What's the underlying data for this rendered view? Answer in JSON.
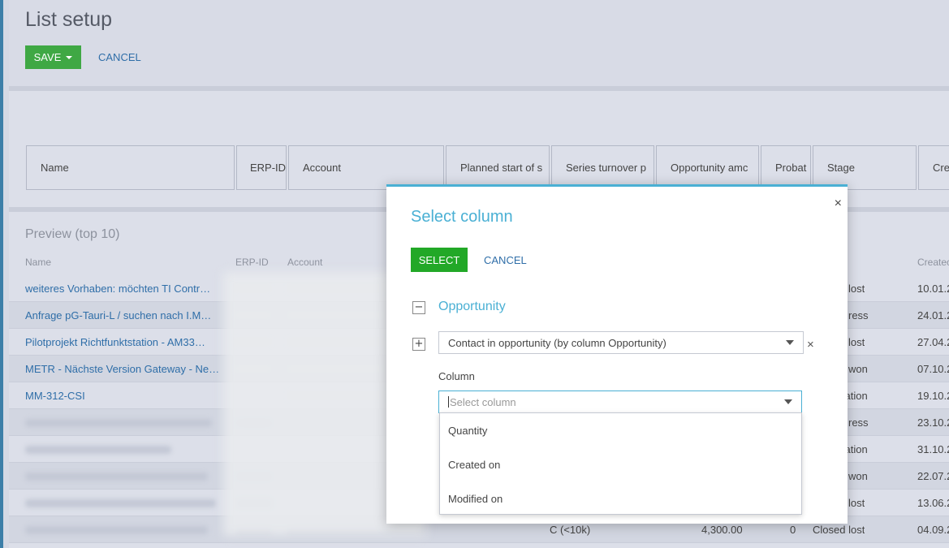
{
  "page": {
    "title": "List setup"
  },
  "toolbar": {
    "save_label": "SAVE",
    "cancel_label": "CANCEL"
  },
  "columns": [
    "Name",
    "ERP-ID",
    "Account",
    "Planned start of s",
    "Series turnover p",
    "Opportunity amc",
    "Probat",
    "Stage",
    "Cre"
  ],
  "preview": {
    "title": "Preview (top 10)",
    "headers": {
      "name": "Name",
      "erp_id": "ERP-ID",
      "account": "Account",
      "created": "Createc"
    },
    "rows": [
      {
        "name": "weiteres Vorhaben: möchten TI Contr…",
        "stage": "lost",
        "created": "10.01.2"
      },
      {
        "name": "Anfrage pG-Tauri-L / suchen nach I.M…",
        "stage": "ress",
        "created": "24.01.2"
      },
      {
        "name": "Pilotprojekt Richtfunktstation - AM33…",
        "stage": "lost",
        "created": "27.04.2"
      },
      {
        "name": "METR - Nächste Version Gateway - Ne…",
        "stage": "won",
        "created": "07.10.2"
      },
      {
        "name": "MM-312-CSI",
        "stage": "cation",
        "created": "19.10.2"
      },
      {
        "name": "",
        "stage": "ress",
        "created": "23.10.2"
      },
      {
        "name": "",
        "stage": "cation",
        "created": "31.10.2"
      },
      {
        "name": "",
        "stage": "won",
        "created": "22.07.2"
      },
      {
        "name": "",
        "stage": "lost",
        "created": "13.06.2"
      },
      {
        "name": "",
        "planned": "C (<10k)",
        "amount": "4,300.00",
        "probability": "0",
        "stage": "Closed lost",
        "created": "04.09.2"
      }
    ]
  },
  "modal": {
    "title": "Select column",
    "close_icon": "×",
    "select_label": "SELECT",
    "cancel_label": "CANCEL",
    "group_toggle": "−",
    "group_label": "Opportunity",
    "sub_toggle": "+",
    "relation_value": "Contact in opportunity (by column Opportunity)",
    "remove_icon": "×",
    "column_label": "Column",
    "column_placeholder": "Select column",
    "options": [
      "Quantity",
      "Created on",
      "Modified on"
    ]
  },
  "colors": {
    "accent": "#4ab0d4",
    "save_green": "#3fa844",
    "select_green": "#22a827",
    "link": "#2f6ea8"
  }
}
